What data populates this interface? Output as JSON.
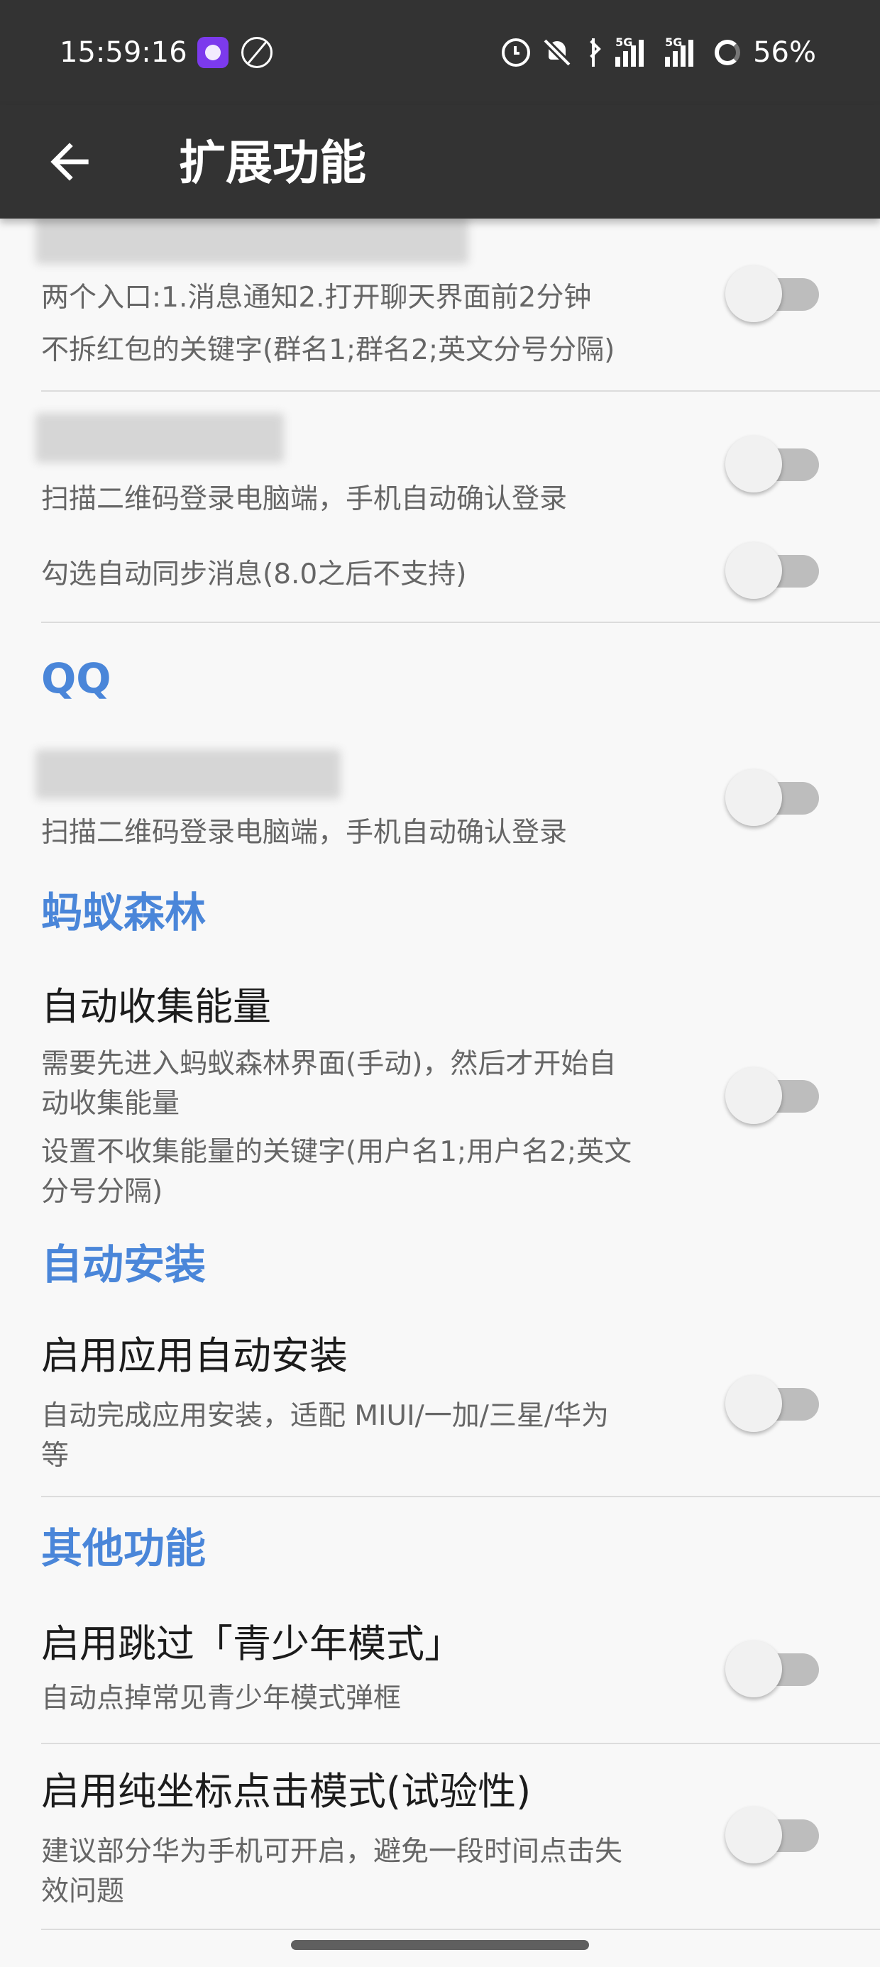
{
  "status_bar": {
    "time": "15:59:16",
    "network_a": "5G",
    "network_b": "5G",
    "battery": "56%"
  },
  "app_bar": {
    "title": "扩展功能"
  },
  "sections": [
    {
      "items": [
        {
          "summary": "两个入口:1.消息通知2.打开聊天界面前2分钟",
          "enabled": false
        },
        {
          "summary": "不拆红包的关键字(群名1;群名2;英文分号分隔)"
        }
      ]
    },
    {
      "items": [
        {
          "summary": "扫描二维码登录电脑端，手机自动确认登录",
          "enabled": false
        },
        {
          "summary": "勾选自动同步消息(8.0之后不支持)",
          "enabled": false
        }
      ]
    },
    {
      "category": "QQ",
      "items": [
        {
          "summary": "扫描二维码登录电脑端，手机自动确认登录",
          "enabled": false
        }
      ]
    },
    {
      "category": "蚂蚁森林",
      "items": [
        {
          "title": "自动收集能量",
          "summary_lines": [
            "需要先进入蚂蚁森林界面(手动)，然后才开始自",
            "动收集能量"
          ],
          "enabled": false
        },
        {
          "summary_lines": [
            "设置不收集能量的关键字(用户名1;用户名2;英文",
            "分号分隔)"
          ]
        }
      ]
    },
    {
      "category": "自动安装",
      "items": [
        {
          "title": "启用应用自动安装",
          "summary_lines": [
            "自动完成应用安装，适配 MIUI/一加/三星/华为",
            "等"
          ],
          "enabled": false
        }
      ]
    },
    {
      "category": "其他功能",
      "items": [
        {
          "title": "启用跳过「青少年模式」",
          "summary": "自动点掉常见青少年模式弹框",
          "enabled": false
        },
        {
          "title": "启用纯坐标点击模式(试验性)",
          "summary_lines": [
            "建议部分华为手机可开启，避免一段时间点击失",
            "效问题"
          ],
          "enabled": false
        }
      ]
    }
  ],
  "colors": {
    "toolbar": "#333333",
    "accent": "#4a86d9",
    "background": "#f8f8f8"
  }
}
